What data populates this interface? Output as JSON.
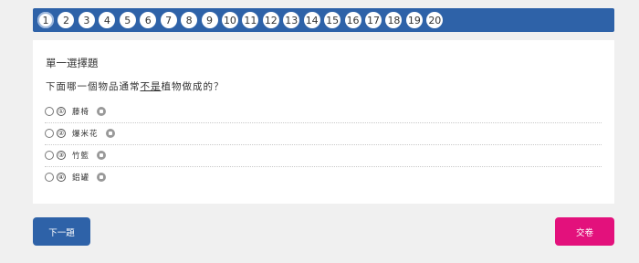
{
  "question_nav": {
    "numbers": [
      "1",
      "2",
      "3",
      "4",
      "5",
      "6",
      "7",
      "8",
      "9",
      "10",
      "11",
      "12",
      "13",
      "14",
      "15",
      "16",
      "17",
      "18",
      "19",
      "20"
    ],
    "active": "1"
  },
  "question": {
    "type_label": "單一選擇題",
    "text_before": "下面哪一個物品通常",
    "text_underlined": "不是",
    "text_after": "植物做成的？"
  },
  "options": [
    {
      "num": "①",
      "text": "藤椅"
    },
    {
      "num": "②",
      "text": "爆米花"
    },
    {
      "num": "③",
      "text": "竹籃"
    },
    {
      "num": "④",
      "text": "鋁罐"
    }
  ],
  "buttons": {
    "next_label": "下一題",
    "submit_label": "交卷"
  },
  "colors": {
    "nav_bg": "#2e62a8",
    "next_bg": "#2e62a8",
    "submit_bg": "#e3117c"
  },
  "icons": {
    "option_sound": "speaker-icon"
  }
}
